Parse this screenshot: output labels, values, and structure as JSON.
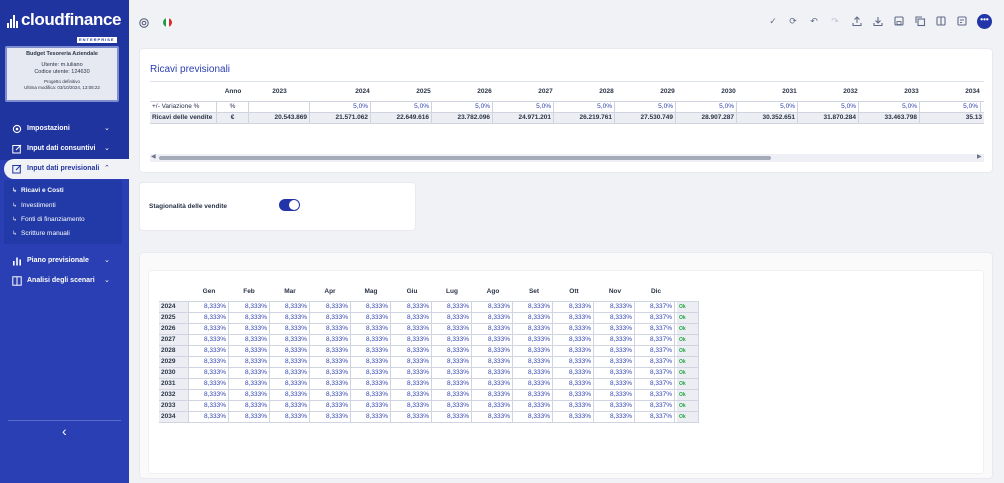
{
  "brand": {
    "name": "cloudfinance",
    "sub": "ENTERPRISE"
  },
  "user_card": {
    "title": "Budget Tesoreria Aziendale",
    "user_line": "Utente: m.iuliano",
    "code_line": "Codice utente: 124630",
    "project": "Progetto definitivo",
    "modified": "Ultima modifica: 03/10/2024, 13:08:22"
  },
  "nav": {
    "items": [
      {
        "label": "Impostazioni"
      },
      {
        "label": "Input dati consuntivi"
      },
      {
        "label": "Input dati previsionali"
      },
      {
        "label": "Piano previsionale"
      },
      {
        "label": "Analisi degli scenari"
      }
    ],
    "sub_items": [
      {
        "label": "Ricavi e Costi"
      },
      {
        "label": "Investimenti"
      },
      {
        "label": "Fonti di finanziamento"
      },
      {
        "label": "Scritture manuali"
      }
    ],
    "collapse_icon": "chevron-left-icon"
  },
  "toolbar": {
    "more_label": "•••"
  },
  "revenue": {
    "title": "Ricavi previsionali",
    "year_header": "Anno",
    "years": [
      "2023",
      "2024",
      "2025",
      "2026",
      "2027",
      "2028",
      "2029",
      "2030",
      "2031",
      "2032",
      "2033",
      "2034"
    ],
    "rows": [
      {
        "label": "+/- Variazione %",
        "unit": "%",
        "values": [
          "",
          "5,0%",
          "5,0%",
          "5,0%",
          "5,0%",
          "5,0%",
          "5,0%",
          "5,0%",
          "5,0%",
          "5,0%",
          "5,0%",
          "5,0%"
        ]
      },
      {
        "label": "Ricavi delle vendite",
        "unit": "€",
        "values": [
          "20.543.869",
          "21.571.062",
          "22.649.616",
          "23.782.096",
          "24.971.201",
          "26.219.761",
          "27.530.749",
          "28.907.287",
          "30.352.651",
          "31.870.284",
          "33.463.798",
          "35.13"
        ]
      }
    ]
  },
  "seasonality": {
    "label": "Stagionalità delle vendite",
    "enabled": true
  },
  "monthly": {
    "months": [
      "Gen",
      "Feb",
      "Mar",
      "Apr",
      "Mag",
      "Giu",
      "Lug",
      "Ago",
      "Set",
      "Ott",
      "Nov",
      "Dic"
    ],
    "rows": [
      {
        "year": "2024",
        "values": [
          "8,333%",
          "8,333%",
          "8,333%",
          "8,333%",
          "8,333%",
          "8,333%",
          "8,333%",
          "8,333%",
          "8,333%",
          "8,333%",
          "8,333%",
          "8,337%"
        ],
        "status": "Ok"
      },
      {
        "year": "2025",
        "values": [
          "8,333%",
          "8,333%",
          "8,333%",
          "8,333%",
          "8,333%",
          "8,333%",
          "8,333%",
          "8,333%",
          "8,333%",
          "8,333%",
          "8,333%",
          "8,337%"
        ],
        "status": "Ok"
      },
      {
        "year": "2026",
        "values": [
          "8,333%",
          "8,333%",
          "8,333%",
          "8,333%",
          "8,333%",
          "8,333%",
          "8,333%",
          "8,333%",
          "8,333%",
          "8,333%",
          "8,333%",
          "8,337%"
        ],
        "status": "Ok"
      },
      {
        "year": "2027",
        "values": [
          "8,333%",
          "8,333%",
          "8,333%",
          "8,333%",
          "8,333%",
          "8,333%",
          "8,333%",
          "8,333%",
          "8,333%",
          "8,333%",
          "8,333%",
          "8,337%"
        ],
        "status": "Ok"
      },
      {
        "year": "2028",
        "values": [
          "8,333%",
          "8,333%",
          "8,333%",
          "8,333%",
          "8,333%",
          "8,333%",
          "8,333%",
          "8,333%",
          "8,333%",
          "8,333%",
          "8,333%",
          "8,337%"
        ],
        "status": "Ok"
      },
      {
        "year": "2029",
        "values": [
          "8,333%",
          "8,333%",
          "8,333%",
          "8,333%",
          "8,333%",
          "8,333%",
          "8,333%",
          "8,333%",
          "8,333%",
          "8,333%",
          "8,333%",
          "8,337%"
        ],
        "status": "Ok"
      },
      {
        "year": "2030",
        "values": [
          "8,333%",
          "8,333%",
          "8,333%",
          "8,333%",
          "8,333%",
          "8,333%",
          "8,333%",
          "8,333%",
          "8,333%",
          "8,333%",
          "8,333%",
          "8,337%"
        ],
        "status": "Ok"
      },
      {
        "year": "2031",
        "values": [
          "8,333%",
          "8,333%",
          "8,333%",
          "8,333%",
          "8,333%",
          "8,333%",
          "8,333%",
          "8,333%",
          "8,333%",
          "8,333%",
          "8,333%",
          "8,337%"
        ],
        "status": "Ok"
      },
      {
        "year": "2032",
        "values": [
          "8,333%",
          "8,333%",
          "8,333%",
          "8,333%",
          "8,333%",
          "8,333%",
          "8,333%",
          "8,333%",
          "8,333%",
          "8,333%",
          "8,333%",
          "8,337%"
        ],
        "status": "Ok"
      },
      {
        "year": "2033",
        "values": [
          "8,333%",
          "8,333%",
          "8,333%",
          "8,333%",
          "8,333%",
          "8,333%",
          "8,333%",
          "8,333%",
          "8,333%",
          "8,333%",
          "8,333%",
          "8,337%"
        ],
        "status": "Ok"
      },
      {
        "year": "2034",
        "values": [
          "8,333%",
          "8,333%",
          "8,333%",
          "8,333%",
          "8,333%",
          "8,333%",
          "8,333%",
          "8,333%",
          "8,333%",
          "8,333%",
          "8,333%",
          "8,337%"
        ],
        "status": "Ok"
      }
    ]
  }
}
